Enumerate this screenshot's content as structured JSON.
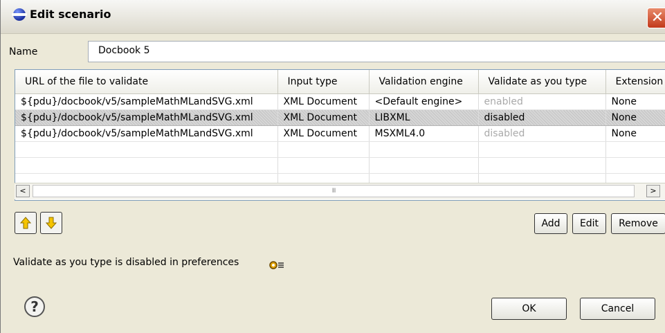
{
  "window": {
    "title": "Edit scenario",
    "close_symbol": "✕"
  },
  "name_field": {
    "label": "Name",
    "value": "Docbook 5"
  },
  "table": {
    "columns": [
      "URL of the file to validate",
      "Input type",
      "Validation engine",
      "Validate as you type",
      "Extension"
    ],
    "rows": [
      {
        "url": "${pdu}/docbook/v5/sampleMathMLandSVG.xml",
        "input_type": "XML Document",
        "engine": "<Default engine>",
        "validate": "enabled",
        "extension": "None"
      },
      {
        "url": "${pdu}/docbook/v5/sampleMathMLandSVG.xml",
        "input_type": "XML Document",
        "engine": "LIBXML",
        "validate": "disabled",
        "extension": "None"
      },
      {
        "url": "${pdu}/docbook/v5/sampleMathMLandSVG.xml",
        "input_type": "XML Document",
        "engine": "MSXML4.0",
        "validate": "disabled",
        "extension": "None"
      }
    ],
    "selected_row_index": 1
  },
  "scrollbar": {
    "left_arrow": "<",
    "right_arrow": ">",
    "grip": "III"
  },
  "buttons": {
    "add": "Add",
    "edit": "Edit",
    "remove": "Remove",
    "ok": "OK",
    "cancel": "Cancel"
  },
  "message": "Validate as you type is disabled in preferences",
  "help_symbol": "?",
  "colors": {
    "move_arrow": "#f5c400",
    "selection": "#cfcfcf",
    "close_button": "#d4512c"
  }
}
